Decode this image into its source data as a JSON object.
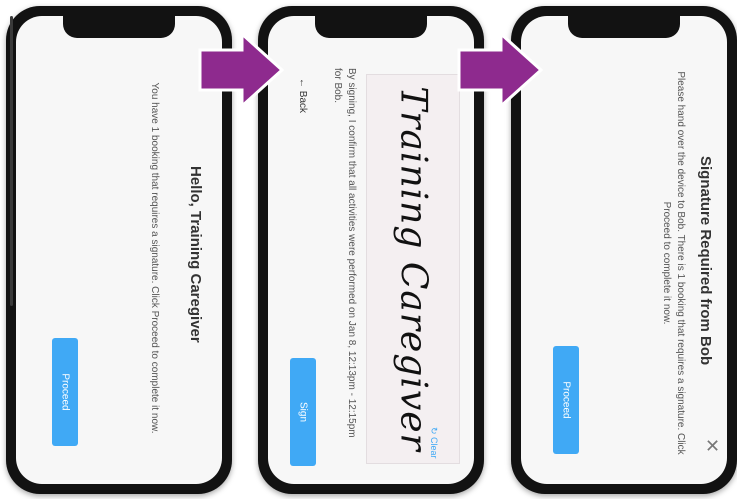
{
  "screen1": {
    "title": "Hello, Training Caregiver",
    "message": "You have 1 booking that requires a signature. Click Proceed to complete it now.",
    "proceed_label": "Proceed"
  },
  "screen2": {
    "confirmation": "By signing, I confirm that all activities were performed on Jan 8, 12:13pm - 12:15pm for Bob.",
    "back_label": "Back",
    "signature_text": "Training Caregiver",
    "clear_label": "Clear",
    "sign_label": "Sign"
  },
  "screen3": {
    "title": "Signature Required from Bob",
    "message": "Please hand over the device to Bob. There is 1 booking that requires a signature. Click Proceed to complete it now.",
    "proceed_label": "Proceed",
    "close_icon": "close-icon"
  },
  "colors": {
    "accent": "#40a9f5",
    "arrow": "#8e2a8e",
    "phone": "#121212"
  }
}
